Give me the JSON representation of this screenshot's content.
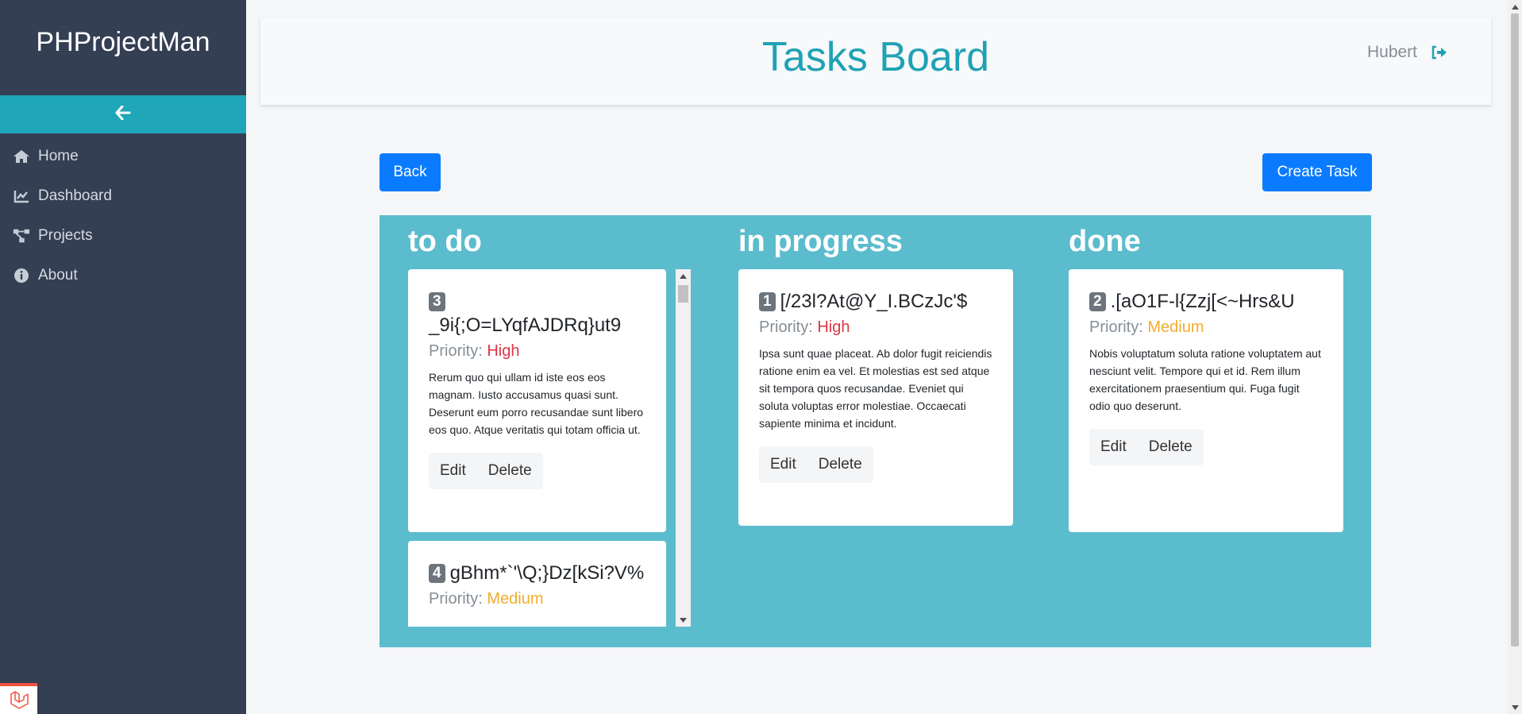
{
  "app": {
    "brand": "PHProjectMan"
  },
  "sidebar": {
    "items": [
      {
        "label": "Home",
        "icon": "home-icon"
      },
      {
        "label": "Dashboard",
        "icon": "chart-line-icon"
      },
      {
        "label": "Projects",
        "icon": "project-diagram-icon"
      },
      {
        "label": "About",
        "icon": "info-circle-icon"
      }
    ]
  },
  "header": {
    "title": "Tasks Board",
    "user": "Hubert"
  },
  "toolbar": {
    "back_label": "Back",
    "create_label": "Create Task"
  },
  "board": {
    "columns": [
      {
        "title": "to do",
        "cards": [
          {
            "id": "3",
            "title": "_9i{;O=LYqfAJDRq}ut9",
            "priority_label": "Priority:",
            "priority": "High",
            "description": "Rerum quo qui ullam id iste eos eos magnam. Iusto accusamus quasi sunt. Deserunt eum porro recusandae sunt libero eos quo. Atque veritatis qui totam officia ut.",
            "edit": "Edit",
            "delete": "Delete"
          },
          {
            "id": "4",
            "title": "gBhm*`'\\Q;}Dz[kSi?V%",
            "priority_label": "Priority:",
            "priority": "Medium"
          }
        ]
      },
      {
        "title": "in progress",
        "cards": [
          {
            "id": "1",
            "title": "[/23l?At@Y_I.BCzJc'$",
            "priority_label": "Priority:",
            "priority": "High",
            "description": "Ipsa sunt quae placeat. Ab dolor fugit reiciendis ratione enim ea vel. Et molestias est sed atque sit tempora quos recusandae. Eveniet qui soluta voluptas error molestiae. Occaecati sapiente minima et incidunt.",
            "edit": "Edit",
            "delete": "Delete"
          }
        ]
      },
      {
        "title": "done",
        "cards": [
          {
            "id": "2",
            "title": ".[aO1F-l{Zzj[<~Hrs&U",
            "priority_label": "Priority:",
            "priority": "Medium",
            "description": "Nobis voluptatum soluta ratione voluptatem aut nesciunt velit. Tempore qui et id. Rem illum exercitationem praesentium qui. Fuga fugit odio quo deserunt.",
            "edit": "Edit",
            "delete": "Delete"
          }
        ]
      }
    ]
  },
  "colors": {
    "sidebar": "#343f53",
    "accent": "#1fa6b8",
    "board": "#5bbccd",
    "primary": "#0a7bff",
    "high": "#dc3545",
    "medium": "#f0ad2e"
  }
}
